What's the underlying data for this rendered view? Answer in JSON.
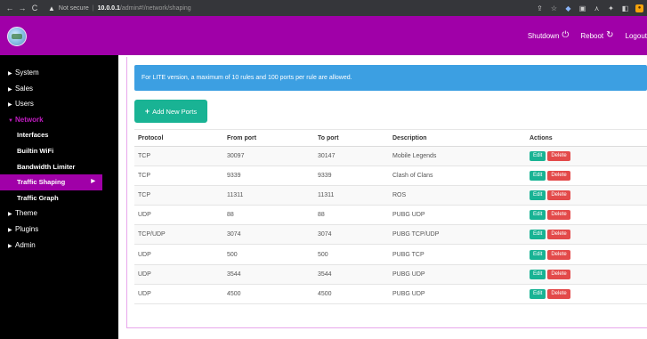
{
  "browser": {
    "not_secure": "Not secure",
    "separator": "|",
    "host": "10.0.0.1",
    "path": "/admin#!/network/shaping"
  },
  "header": {
    "shutdown_label": "Shutdown",
    "reboot_label": "Reboot",
    "logout_label": "Logout"
  },
  "sidebar": {
    "items": [
      {
        "label": "System"
      },
      {
        "label": "Sales"
      },
      {
        "label": "Users"
      },
      {
        "label": "Network"
      },
      {
        "label": "Interfaces"
      },
      {
        "label": "Builtin WiFi"
      },
      {
        "label": "Bandwidth Limiter"
      },
      {
        "label": "Traffic Shaping"
      },
      {
        "label": "Traffic Graph"
      },
      {
        "label": "Theme"
      },
      {
        "label": "Plugins"
      },
      {
        "label": "Admin"
      }
    ]
  },
  "main": {
    "alert_text": "For LITE version, a maximum of 10 rules and 100 ports per rule are allowed.",
    "add_button_label": "Add New Ports",
    "table": {
      "headers": [
        "Protocol",
        "From port",
        "To port",
        "Description",
        "Actions"
      ],
      "rows": [
        {
          "protocol": "TCP",
          "from": "30097",
          "to": "30147",
          "description": "Mobile Legends"
        },
        {
          "protocol": "TCP",
          "from": "9339",
          "to": "9339",
          "description": "Clash of Clans"
        },
        {
          "protocol": "TCP",
          "from": "11311",
          "to": "11311",
          "description": "ROS"
        },
        {
          "protocol": "UDP",
          "from": "88",
          "to": "88",
          "description": "PUBG UDP"
        },
        {
          "protocol": "TCP/UDP",
          "from": "3074",
          "to": "3074",
          "description": "PUBG TCP/UDP"
        },
        {
          "protocol": "UDP",
          "from": "500",
          "to": "500",
          "description": "PUBG TCP"
        },
        {
          "protocol": "UDP",
          "from": "3544",
          "to": "3544",
          "description": "PUBG UDP"
        },
        {
          "protocol": "UDP",
          "from": "4500",
          "to": "4500",
          "description": "PUBG UDP"
        }
      ],
      "edit_label": "Edit",
      "delete_label": "Delete"
    }
  },
  "colors": {
    "brand_purple": "#a000a8",
    "alert_blue": "#3c9fe2",
    "edit_green": "#19b394",
    "delete_red": "#e34a4a",
    "sidebar_bg": "#000000"
  },
  "icons": {
    "back": "arrow-left-icon",
    "forward": "arrow-right-icon",
    "reload": "reload-icon",
    "warning": "warning-icon",
    "power": "power-icon",
    "reboot": "refresh-icon",
    "add": "plus-icon",
    "caret": "caret-right-icon"
  }
}
